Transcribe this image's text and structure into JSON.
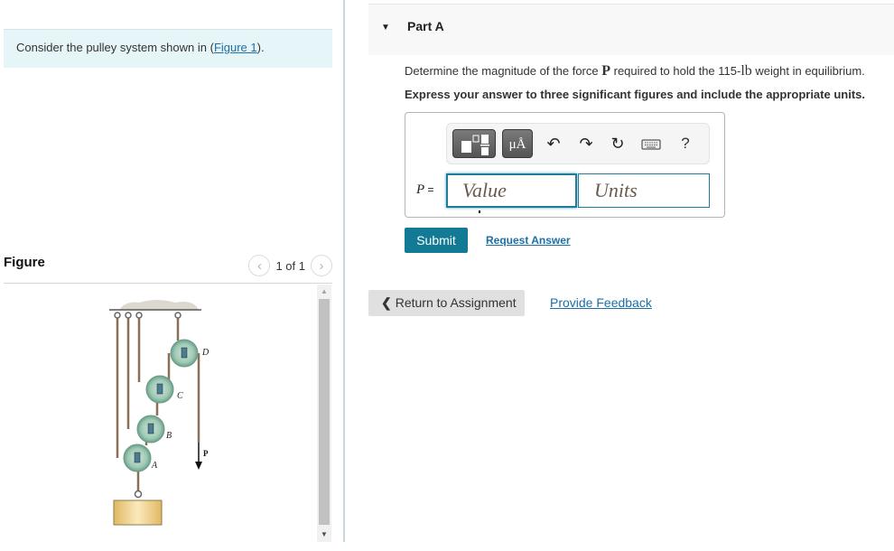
{
  "left": {
    "intro_text": "Consider the pulley system shown in (",
    "intro_link": "Figure 1",
    "intro_end": ").",
    "figure_title": "Figure",
    "pager": {
      "prev_icon": "chevron-left",
      "label": "1 of 1",
      "next_icon": "chevron-right"
    },
    "figure": {
      "pulley_labels": [
        "A",
        "B",
        "C",
        "D"
      ],
      "force_label": "P"
    }
  },
  "part": {
    "caret_icon": "triangle-down",
    "title": "Part A"
  },
  "question": {
    "text_before": "Determine the magnitude of the force ",
    "force_symbol": "P",
    "text_middle": " required to hold the 115-",
    "unit_symbol": "lb",
    "text_after": " weight in equilibrium.",
    "instruction": "Express your answer to three significant figures and include the appropriate units."
  },
  "answer": {
    "toolbar": {
      "template_icon": "templates-icon",
      "units_label": "μÅ",
      "undo_icon": "undo",
      "redo_icon": "redo",
      "reset_icon": "reset",
      "keyboard_icon": "keyboard",
      "help_label": "?"
    },
    "variable": "P",
    "equals": " =",
    "value_placeholder": "Value",
    "units_placeholder": "Units"
  },
  "actions": {
    "submit": "Submit",
    "request_answer": "Request Answer",
    "return": "Return to Assignment",
    "feedback": "Provide Feedback"
  },
  "colors": {
    "accent": "#137a96",
    "link": "#1d6fa5",
    "intro_bg": "#e6f5f7"
  }
}
